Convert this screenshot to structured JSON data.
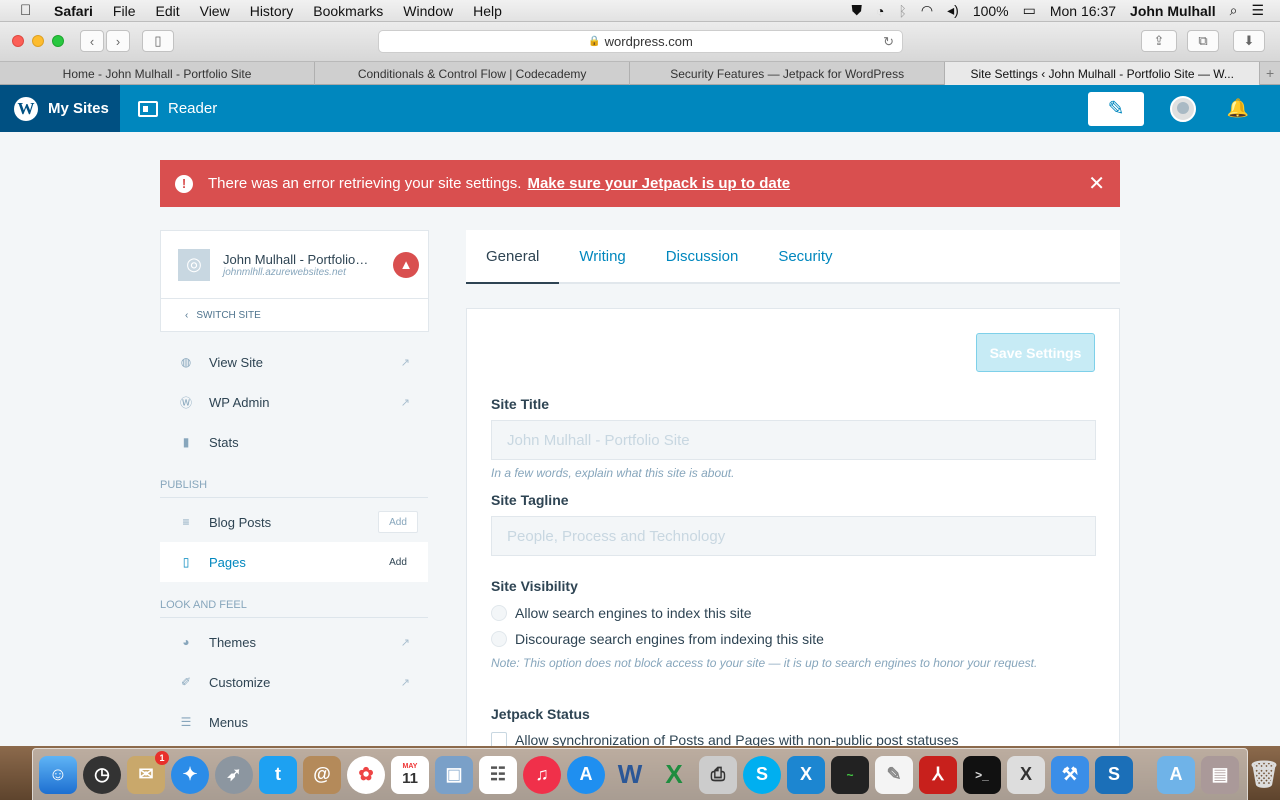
{
  "menubar": {
    "app": "Safari",
    "items": [
      "File",
      "Edit",
      "View",
      "History",
      "Bookmarks",
      "Window",
      "Help"
    ],
    "battery": "100%",
    "clock": "Mon 16:37",
    "user": "John Mulhall"
  },
  "browser": {
    "url": "wordpress.com",
    "tabs": [
      {
        "title": "Home - John Mulhall - Portfolio Site"
      },
      {
        "title": "Conditionals & Control Flow | Codecademy"
      },
      {
        "title": "Security Features — Jetpack for WordPress"
      },
      {
        "title": "Site Settings ‹ John Mulhall - Portfolio Site — W..."
      }
    ]
  },
  "masterbar": {
    "my_sites": "My Sites",
    "reader": "Reader",
    "accent": "#0087be"
  },
  "notice": {
    "message": "There was an error retrieving your site settings.",
    "link": "Make sure your Jetpack is up to date",
    "color": "#d94f4f"
  },
  "sidebar": {
    "site_name": "John Mulhall - Portfolio Site",
    "site_url": "johnmlhll.azurewebsites.net",
    "switch_site": "SWITCH SITE",
    "top_items": [
      {
        "label": "View Site",
        "icon": "globe-icon"
      },
      {
        "label": "WP Admin",
        "icon": "wordpress-icon"
      },
      {
        "label": "Stats",
        "icon": "stats-icon"
      }
    ],
    "publish_heading": "PUBLISH",
    "publish_items": [
      {
        "label": "Blog Posts",
        "action": "Add"
      },
      {
        "label": "Pages",
        "action": "Add"
      }
    ],
    "look_heading": "LOOK AND FEEL",
    "look_items": [
      {
        "label": "Themes"
      },
      {
        "label": "Customize"
      },
      {
        "label": "Menus"
      }
    ]
  },
  "settings": {
    "tabs": [
      "General",
      "Writing",
      "Discussion",
      "Security"
    ],
    "save_label": "Save Settings",
    "site_title_label": "Site Title",
    "site_title_value": "John Mulhall - Portfolio Site",
    "site_title_help": "In a few words, explain what this site is about.",
    "tagline_label": "Site Tagline",
    "tagline_value": "People, Process and Technology",
    "visibility_label": "Site Visibility",
    "visibility_options": [
      "Allow search engines to index this site",
      "Discourage search engines from indexing this site"
    ],
    "visibility_note": "Note: This option does not block access to your site — it is up to search engines to honor your request.",
    "jetpack_label": "Jetpack Status",
    "jetpack_option": "Allow synchronization of Posts and Pages with non-public post statuses"
  },
  "dock": {
    "mail_badge": "1",
    "calendar_month": "MAY",
    "calendar_day": "11"
  }
}
